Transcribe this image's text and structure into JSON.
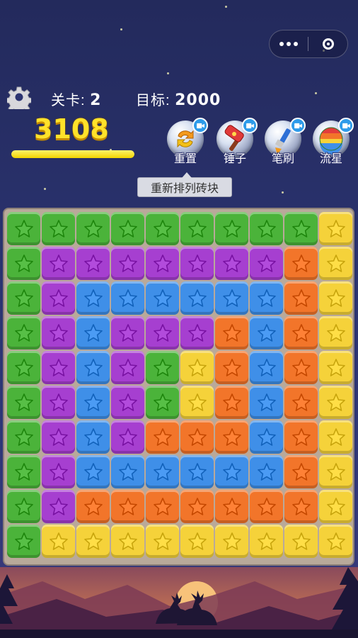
{
  "capsule": {
    "more_icon": "more-dots-icon",
    "close_icon": "target-circle-icon"
  },
  "hud": {
    "level_label": "关卡:",
    "level_value": "2",
    "target_label": "目标:",
    "target_value": "2000",
    "score": "3108",
    "progress": 1.0
  },
  "tools": [
    {
      "name": "reset",
      "label": "重置",
      "icon": "shuffle-arrows-icon"
    },
    {
      "name": "hammer",
      "label": "锤子",
      "icon": "hammer-icon"
    },
    {
      "name": "brush",
      "label": "笔刷",
      "icon": "brush-icon"
    },
    {
      "name": "meteor",
      "label": "流星",
      "icon": "rainbow-ball-icon"
    }
  ],
  "tooltip": "重新排列砖块",
  "colors": {
    "G": "#4bb33a",
    "P": "#a63fd0",
    "B": "#3f8fe8",
    "O": "#f2752a",
    "Y": "#f5d23a",
    "accent": "#ffe22a"
  },
  "board": [
    [
      "G",
      "G",
      "G",
      "G",
      "G",
      "G",
      "G",
      "G",
      "G",
      "Y"
    ],
    [
      "G",
      "P",
      "P",
      "P",
      "P",
      "P",
      "P",
      "P",
      "O",
      "Y"
    ],
    [
      "G",
      "P",
      "B",
      "B",
      "B",
      "B",
      "B",
      "B",
      "O",
      "Y"
    ],
    [
      "G",
      "P",
      "B",
      "P",
      "P",
      "P",
      "O",
      "B",
      "O",
      "Y"
    ],
    [
      "G",
      "P",
      "B",
      "P",
      "G",
      "Y",
      "O",
      "B",
      "O",
      "Y"
    ],
    [
      "G",
      "P",
      "B",
      "P",
      "G",
      "Y",
      "O",
      "B",
      "O",
      "Y"
    ],
    [
      "G",
      "P",
      "B",
      "P",
      "O",
      "O",
      "O",
      "B",
      "O",
      "Y"
    ],
    [
      "G",
      "P",
      "B",
      "B",
      "B",
      "B",
      "B",
      "B",
      "O",
      "Y"
    ],
    [
      "G",
      "P",
      "O",
      "O",
      "O",
      "O",
      "O",
      "O",
      "O",
      "Y"
    ],
    [
      "G",
      "Y",
      "Y",
      "Y",
      "Y",
      "Y",
      "Y",
      "Y",
      "Y",
      "Y"
    ]
  ]
}
